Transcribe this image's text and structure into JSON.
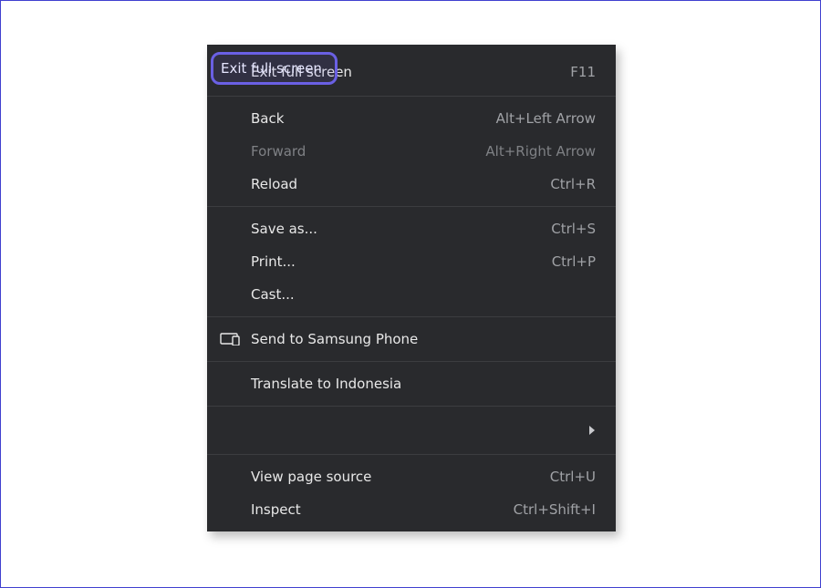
{
  "menu": {
    "items": [
      {
        "label": "Exit full screen",
        "shortcut": "F11"
      },
      {
        "label": "Back",
        "shortcut": "Alt+Left Arrow"
      },
      {
        "label": "Forward",
        "shortcut": "Alt+Right Arrow"
      },
      {
        "label": "Reload",
        "shortcut": "Ctrl+R"
      },
      {
        "label": "Save as...",
        "shortcut": "Ctrl+S"
      },
      {
        "label": "Print...",
        "shortcut": "Ctrl+P"
      },
      {
        "label": "Cast..."
      },
      {
        "label": "Send to Samsung Phone"
      },
      {
        "label": "Translate to Indonesia"
      },
      {
        "label": "View page source",
        "shortcut": "Ctrl+U"
      },
      {
        "label": "Inspect",
        "shortcut": "Ctrl+Shift+I"
      }
    ]
  },
  "highlight": {
    "label": "Exit full screen"
  }
}
